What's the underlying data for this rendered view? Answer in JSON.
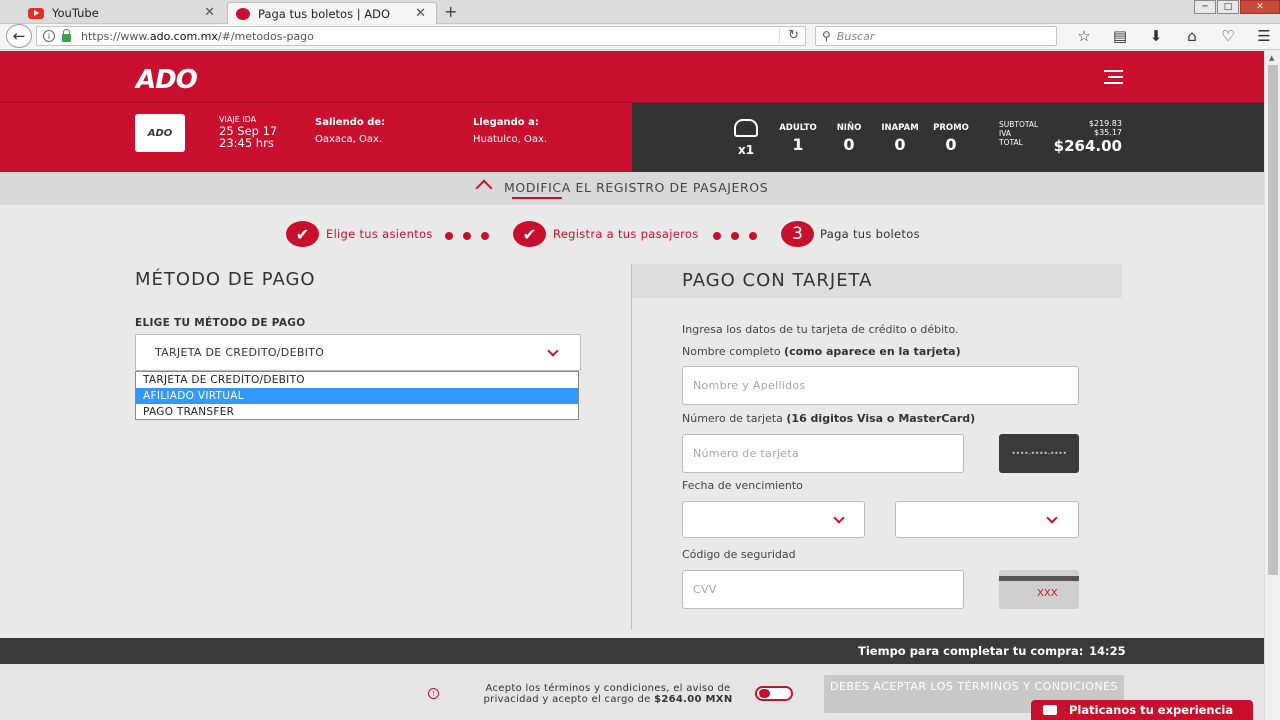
{
  "browser": {
    "tabs": [
      {
        "title": "YouTube",
        "active": false
      },
      {
        "title": "Paga tus boletos | ADO",
        "active": true
      }
    ],
    "url_prefix": "https://www.",
    "url_domain": "ado.com.mx",
    "url_path": "/#/metodos-pago",
    "search_placeholder": "Buscar"
  },
  "header": {
    "logo": "ADO",
    "trip_logo": "ADO"
  },
  "trip": {
    "viaje_label": "VIAJE IDA",
    "date": "25 Sep 17",
    "time": "23:45 hrs",
    "saliendo_label": "Saliendo de:",
    "saliendo_city": "Oaxaca, Oax.",
    "llegando_label": "Llegando a:",
    "llegando_city": "Huatulco, Oax.",
    "passenger_count": "x1",
    "categories": [
      {
        "label": "ADULTO",
        "value": "1"
      },
      {
        "label": "NIÑO",
        "value": "0"
      },
      {
        "label": "INAPAM",
        "value": "0"
      },
      {
        "label": "PROMO",
        "value": "0"
      }
    ],
    "subtotal_label": "SUBTOTAL",
    "iva_label": "IVA",
    "total_label": "TOTAL",
    "subtotal": "$219.83",
    "iva": "$35.17",
    "total": "$264.00"
  },
  "modifica": "MODIFICA EL REGISTRO DE PASAJEROS",
  "steps": [
    {
      "label": "Elige tus asientos"
    },
    {
      "label": "Registra a tus pasajeros"
    },
    {
      "label": "Paga tus boletos",
      "number": "3"
    }
  ],
  "metodo": {
    "title": "MÉTODO DE PAGO",
    "select_label": "ELIGE TU MÉTODO DE PAGO",
    "selected": "TARJETA DE CREDITO/DEBITO",
    "options": [
      "TARJETA DE CREDITO/DEBITO",
      "AFILIADO VIRTUAL",
      "PAGO TRANSFER"
    ]
  },
  "tarjeta": {
    "title": "PAGO CON TARJETA",
    "intro": "Ingresa los datos de tu tarjeta de crédito o débito.",
    "nombre_label": "Nombre completo",
    "nombre_hint": "(como aparece en la tarjeta)",
    "nombre_placeholder": "Nombre y Apellidos",
    "numero_label": "Número de tarjeta",
    "numero_hint": "(16 digitos Visa o MasterCard)",
    "numero_placeholder": "Número de tarjeta",
    "card_mask": "••••-••••-••••",
    "fecha_label": "Fecha de vencimiento",
    "codigo_label": "Código de seguridad",
    "cvv_placeholder": "CVV",
    "cvv_sample": "XXX"
  },
  "footer": {
    "timer_label": "Tiempo para completar tu compra:",
    "timer_value": "14:25",
    "terms_text": "Acepto los términos y condiciones, el aviso de privacidad y acepto el cargo de",
    "terms_amount": "$264.00 MXN",
    "accept_button": "DEBES ACEPTAR LOS TÉRMINOS Y CONDICIONES",
    "chat_button": "Platicanos tu experiencia"
  },
  "colors": {
    "brand_red": "#c8102e",
    "dark": "#333333",
    "selected_option": "#3399ff"
  }
}
